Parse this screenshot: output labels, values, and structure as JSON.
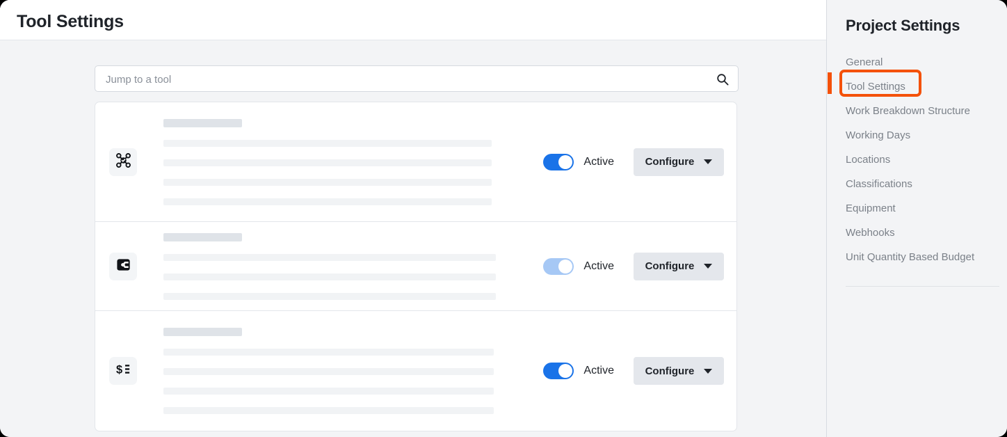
{
  "header": {
    "title": "Tool Settings"
  },
  "search": {
    "placeholder": "Jump to a tool",
    "value": "",
    "icon": "search-icon"
  },
  "tools": [
    {
      "icon": "network-nodes-check-icon",
      "skeleton": {
        "title_width": 113,
        "line_widths": [
          472,
          472,
          472,
          472
        ]
      },
      "toggle": {
        "state": "on",
        "style": "active",
        "label": "Active"
      },
      "action": {
        "label": "Configure",
        "caret": "chevron-down-icon"
      }
    },
    {
      "icon": "procore-logo-icon",
      "skeleton": {
        "title_width": 113,
        "line_widths": [
          478,
          478,
          478
        ]
      },
      "toggle": {
        "state": "on",
        "style": "muted",
        "label": "Active"
      },
      "action": {
        "label": "Configure",
        "caret": "chevron-down-icon"
      }
    },
    {
      "icon": "dollar-list-icon",
      "skeleton": {
        "title_width": 113,
        "line_widths": [
          475,
          475,
          475,
          475
        ]
      },
      "toggle": {
        "state": "on",
        "style": "active",
        "label": "Active"
      },
      "action": {
        "label": "Configure",
        "caret": "chevron-down-icon"
      }
    }
  ],
  "sidebar": {
    "title": "Project Settings",
    "items": [
      {
        "label": "General"
      },
      {
        "label": "Tool Settings"
      },
      {
        "label": "Work Breakdown Structure"
      },
      {
        "label": "Working Days"
      },
      {
        "label": "Locations"
      },
      {
        "label": "Classifications"
      },
      {
        "label": "Equipment"
      },
      {
        "label": "Webhooks"
      },
      {
        "label": "Unit Quantity Based Budget"
      }
    ]
  },
  "annotation": {
    "color": "#f4510a",
    "target": "Tool Settings"
  }
}
